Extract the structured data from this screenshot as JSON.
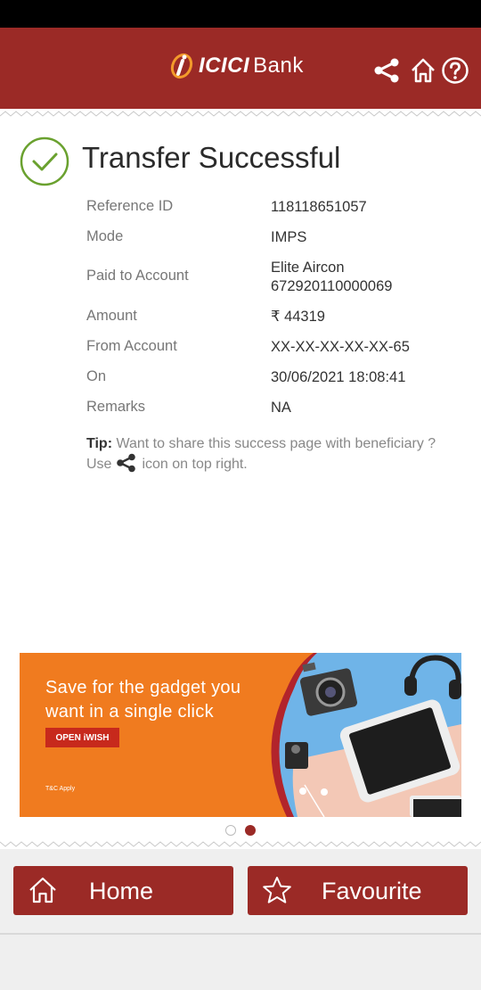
{
  "header": {
    "brand_name": "ICICI",
    "brand_suffix": "Bank",
    "share_icon": "share-icon",
    "home_icon": "home-icon",
    "help_icon": "help-icon",
    "color": "#9b2a26"
  },
  "result": {
    "title": "Transfer Successful",
    "icon": "check-circle-icon"
  },
  "details": [
    {
      "label": "Reference ID",
      "value": "118118651057"
    },
    {
      "label": "Mode",
      "value": "IMPS"
    },
    {
      "label": "Paid to Account",
      "value": "Elite Aircon",
      "value2": "672920110000069"
    },
    {
      "label": "Amount",
      "value": "₹ 44319"
    },
    {
      "label": "From Account",
      "value": "XX-XX-XX-XX-XX-65"
    },
    {
      "label": "On",
      "value": "30/06/2021 18:08:41"
    },
    {
      "label": "Remarks",
      "value": "NA"
    }
  ],
  "tip": {
    "prefix": "Tip:",
    "text_before": "Want to share this success page with beneficiary ? Use",
    "text_after": "icon on top right."
  },
  "banner": {
    "line1": "Save for the gadget you",
    "line2": "want in a single click",
    "cta": "OPEN iWISH",
    "tnc": "T&C Apply",
    "active_slide": 2,
    "total_slides": 2
  },
  "footer": {
    "home_label": "Home",
    "favourite_label": "Favourite"
  }
}
